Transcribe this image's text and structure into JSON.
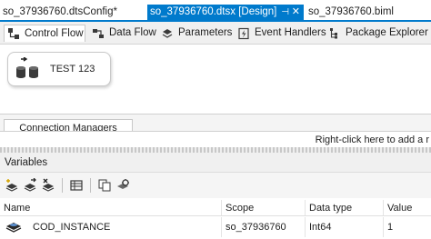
{
  "document_tabs": [
    {
      "label": "so_37936760.dtsConfig*",
      "active": false
    },
    {
      "label": "so_37936760.dtsx [Design]",
      "active": true
    },
    {
      "label": "so_37936760.biml",
      "active": false
    }
  ],
  "designer_tabs": [
    {
      "label": "Control Flow",
      "icon": "control-flow-icon",
      "active": true
    },
    {
      "label": "Data Flow",
      "icon": "data-flow-icon",
      "active": false
    },
    {
      "label": "Parameters",
      "icon": "parameters-icon",
      "active": false
    },
    {
      "label": "Event Handlers",
      "icon": "event-handlers-icon",
      "active": false
    },
    {
      "label": "Package Explorer",
      "icon": "package-explorer-icon",
      "active": false
    }
  ],
  "canvas": {
    "task": {
      "label": "TEST 123",
      "icon": "execute-sql-task-icon"
    }
  },
  "connection_managers": {
    "tab_label": "Connection Managers",
    "hint": "Right-click here to add a r"
  },
  "variables": {
    "title": "Variables",
    "toolbar_icons": [
      "add-variable-icon",
      "move-variable-icon",
      "delete-variable-icon",
      "grid-options-icon",
      "copy-icon",
      "properties-icon"
    ],
    "columns": [
      "Name",
      "Scope",
      "Data type",
      "Value"
    ],
    "rows": [
      {
        "name": "COD_INSTANCE",
        "scope": "so_37936760",
        "data_type": "Int64",
        "value": "1"
      }
    ]
  },
  "colors": {
    "accent": "#007acc",
    "background": "#ffffff",
    "panel": "#f0f0f0"
  }
}
